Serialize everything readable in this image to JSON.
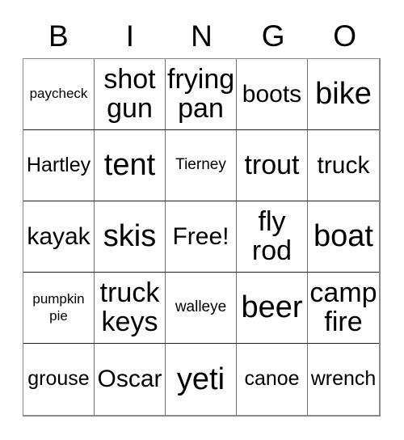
{
  "card": {
    "header_letters": [
      "B",
      "I",
      "N",
      "G",
      "O"
    ],
    "free_space_label": "Free!",
    "grid": {
      "rows": 5,
      "columns": 5,
      "cells": [
        [
          {
            "text": "paycheck",
            "size": "xs",
            "lines": 1
          },
          {
            "text": "shot\ngun",
            "size": "xl",
            "lines": 2
          },
          {
            "text": "frying\npan",
            "size": "xl",
            "lines": 2
          },
          {
            "text": "boots",
            "size": "l",
            "lines": 1
          },
          {
            "text": "bike",
            "size": "xxl",
            "lines": 1
          }
        ],
        [
          {
            "text": "Hartley",
            "size": "m",
            "lines": 1
          },
          {
            "text": "tent",
            "size": "xxl",
            "lines": 1
          },
          {
            "text": "Tierney",
            "size": "s",
            "lines": 1
          },
          {
            "text": "trout",
            "size": "xl",
            "lines": 1
          },
          {
            "text": "truck",
            "size": "l",
            "lines": 1
          }
        ],
        [
          {
            "text": "kayak",
            "size": "l",
            "lines": 1
          },
          {
            "text": "skis",
            "size": "xxl",
            "lines": 1
          },
          {
            "text": "Free!",
            "size": "l",
            "lines": 1
          },
          {
            "text": "fly\nrod",
            "size": "xl",
            "lines": 2
          },
          {
            "text": "boat",
            "size": "xxl",
            "lines": 1
          }
        ],
        [
          {
            "text": "pumpkin\npie",
            "size": "xs",
            "lines": 2
          },
          {
            "text": "truck\nkeys",
            "size": "xl",
            "lines": 2
          },
          {
            "text": "walleye",
            "size": "s",
            "lines": 1
          },
          {
            "text": "beer",
            "size": "xxl",
            "lines": 1
          },
          {
            "text": "camp\nfire",
            "size": "xl",
            "lines": 2
          }
        ],
        [
          {
            "text": "grouse",
            "size": "m",
            "lines": 1
          },
          {
            "text": "Oscar",
            "size": "l",
            "lines": 1
          },
          {
            "text": "yeti",
            "size": "xxl",
            "lines": 1
          },
          {
            "text": "canoe",
            "size": "m",
            "lines": 1
          },
          {
            "text": "wrench",
            "size": "m",
            "lines": 1
          }
        ]
      ]
    },
    "colors": {
      "background": "#ffffff",
      "text": "#000000",
      "grid_line": "#6f6f6f",
      "grid_outer": "#8a8a8a"
    }
  }
}
